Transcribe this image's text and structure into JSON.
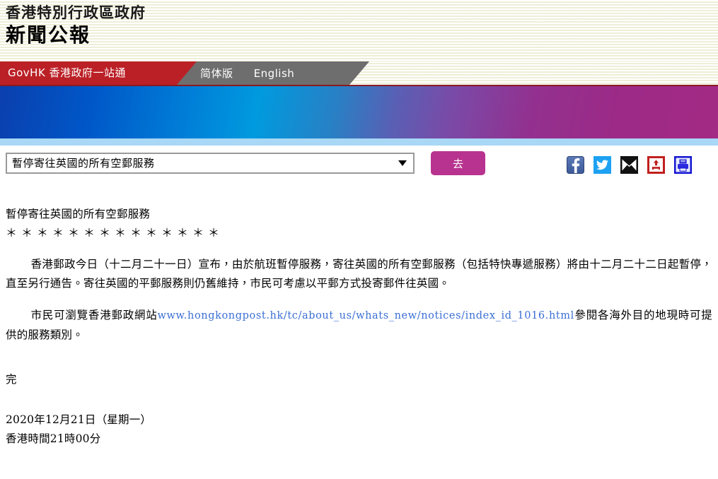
{
  "masthead": {
    "government_line": "香港特別行政區政府",
    "title": "新聞公報"
  },
  "nav": {
    "govhk_label": "GovHK 香港政府一站通",
    "links": [
      {
        "label": "简体版"
      },
      {
        "label": "English"
      }
    ]
  },
  "controls": {
    "selected_option": "暫停寄往英國的所有空郵服務",
    "go_label": "去",
    "dropdown_icon": "chevron-down-icon",
    "social_icons": [
      {
        "name": "facebook-icon",
        "label": "f",
        "color": "#3b5998"
      },
      {
        "name": "twitter-icon",
        "label": "",
        "color": "#1da1f2"
      },
      {
        "name": "email-icon",
        "label": "",
        "color": "#000000"
      },
      {
        "name": "download-icon",
        "label": "",
        "color": "#c0201e"
      },
      {
        "name": "print-icon",
        "label": "",
        "color": "#1414d2"
      }
    ]
  },
  "article": {
    "headline": "暫停寄往英國的所有空郵服務",
    "separator": "＊＊＊＊＊＊＊＊＊＊＊＊＊＊",
    "body_paragraph": "香港郵政今日（十二月二十一日）宣布，由於航班暫停服務，寄往英國的所有空郵服務（包括特快專遞服務）將由十二月二十二日起暫停，直至另行通告。寄往英國的平郵服務則仍舊維持，市民可考慮以平郵方式投寄郵件往英國。",
    "link_paragraph_before": "市民可瀏覽香港郵政網站",
    "link_url": "www.hongkongpost.hk/tc/about_us/whats_new/notices/index_id_1016.html",
    "link_paragraph_after": "參閱各海外目的地現時可提供的服務類別。",
    "end_mark": "完",
    "date": "2020年12月21日（星期一）",
    "time": "香港時間21時00分"
  },
  "colors": {
    "nav_red": "#bb2026",
    "nav_gray": "#6e6e6e",
    "go_button": "#b8338f",
    "link_blue": "#3b6fd4",
    "banner_underline": "#a8d8f5",
    "masthead_cream": "#f8f7e6"
  }
}
